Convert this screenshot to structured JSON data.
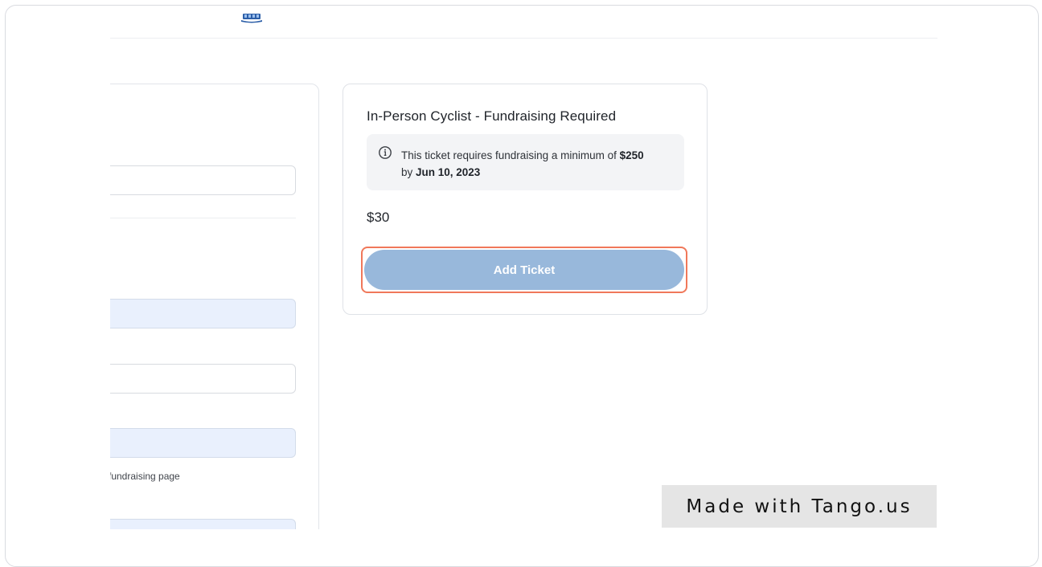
{
  "ticket": {
    "title": "In-Person Cyclist - Fundraising Required",
    "notice": {
      "icon": "info-icon",
      "text_before": "This ticket requires fundraising a minimum of ",
      "min_amount": "$250",
      "text_by": " by ",
      "deadline": "Jun 10, 2023"
    },
    "price": "$30",
    "add_button_label": "Add Ticket"
  },
  "form": {
    "help_text": "i fundraising page"
  },
  "badge": {
    "text": "Made with Tango.us"
  },
  "colors": {
    "button_fill": "#98b8db",
    "highlight_outline": "#f0785a",
    "filled_field": "#e9f0fd"
  }
}
